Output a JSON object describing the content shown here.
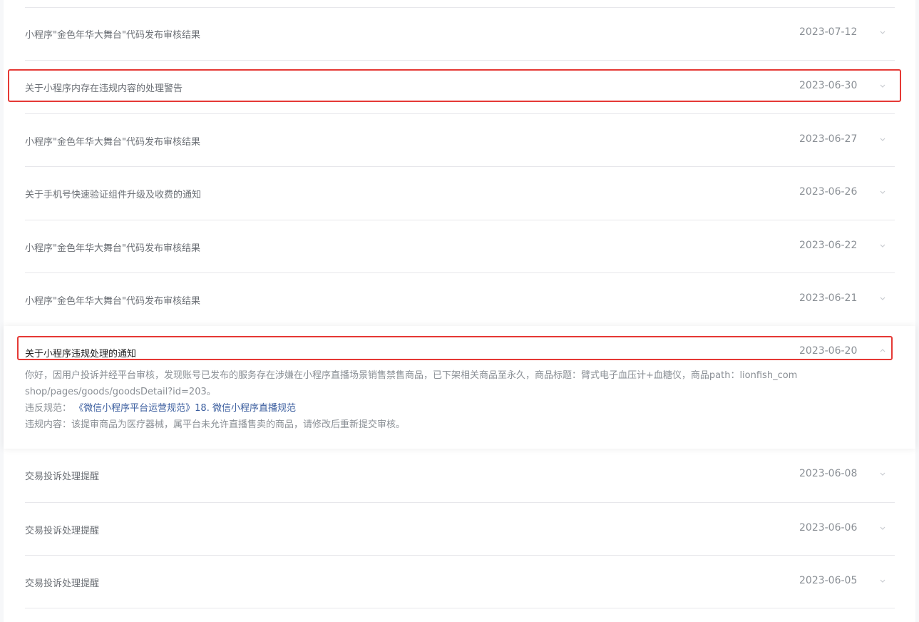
{
  "notices": [
    {
      "title": "小程序\"金色年华大舞台\"代码发布审核结果",
      "date": "2023-07-12",
      "chevron": "chevron-down-icon"
    },
    {
      "title": "关于小程序内存在违规内容的处理警告",
      "date": "2023-06-30",
      "chevron": "chevron-down-icon"
    },
    {
      "title": "小程序\"金色年华大舞台\"代码发布审核结果",
      "date": "2023-06-27",
      "chevron": "chevron-down-icon"
    },
    {
      "title": "关于手机号快速验证组件升级及收费的通知",
      "date": "2023-06-26",
      "chevron": "chevron-down-icon"
    },
    {
      "title": "小程序\"金色年华大舞台\"代码发布审核结果",
      "date": "2023-06-22",
      "chevron": "chevron-down-icon"
    },
    {
      "title": "小程序\"金色年华大舞台\"代码发布审核结果",
      "date": "2023-06-21",
      "chevron": "chevron-down-icon"
    }
  ],
  "expanded": {
    "title": "关于小程序违规处理的通知",
    "date": "2023-06-20",
    "chevron": "chevron-up-icon",
    "body_line1": "你好，因用户投诉并经平台审核，发现账号已发布的服务存在涉嫌在小程序直播场景销售禁售商品，已下架相关商品至永久，商品标题：臂式电子血压计+血糖仪，商品path：lionfish_com",
    "body_line2": "shop/pages/goods/goodsDetail?id=203。",
    "rule_label": "违反规范：",
    "rule_link": "《微信小程序平台运营规范》18. 微信小程序直播规范",
    "violation": "违规内容：该提审商品为医疗器械，属平台未允许直播售卖的商品，请修改后重新提交审核。"
  },
  "notices_after": [
    {
      "title": "交易投诉处理提醒",
      "date": "2023-06-08",
      "chevron": "chevron-down-icon"
    },
    {
      "title": "交易投诉处理提醒",
      "date": "2023-06-06",
      "chevron": "chevron-down-icon"
    },
    {
      "title": "交易投诉处理提醒",
      "date": "2023-06-05",
      "chevron": "chevron-down-icon"
    }
  ],
  "colors": {
    "highlight": "#e53935",
    "link": "#3a5d9e",
    "text_muted": "#8a8f95"
  }
}
